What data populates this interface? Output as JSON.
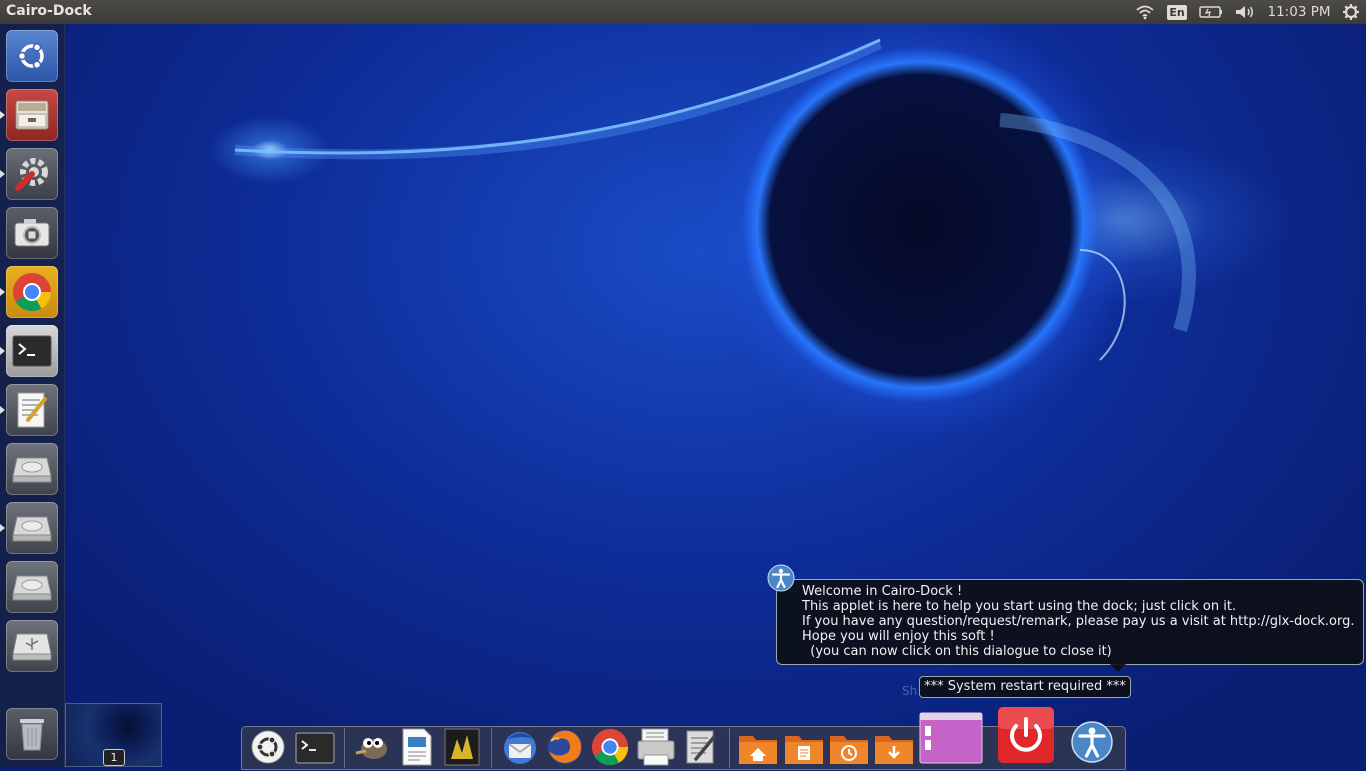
{
  "top_panel": {
    "app_title": "Cairo-Dock",
    "keyboard_layout": "En",
    "clock": "11:03 PM"
  },
  "launcher": {
    "items": [
      {
        "icon": "ubuntu-dash-icon"
      },
      {
        "icon": "file-cabinet-icon",
        "running": true
      },
      {
        "icon": "system-settings-icon",
        "running": true
      },
      {
        "icon": "camera-icon"
      },
      {
        "icon": "chrome-icon",
        "running": true
      },
      {
        "icon": "terminal-icon",
        "running": true
      },
      {
        "icon": "text-editor-icon",
        "running": true
      },
      {
        "icon": "hard-drive-icon"
      },
      {
        "icon": "hard-drive-icon",
        "running": true
      },
      {
        "icon": "hard-drive-icon"
      },
      {
        "icon": "usb-drive-icon"
      },
      {
        "icon": "trash-icon"
      }
    ]
  },
  "workspace": {
    "number": "1"
  },
  "dialog": {
    "line1": "Welcome in Cairo-Dock !",
    "line2": "This applet is here to help you start using the dock; just click on it.",
    "line3": "If you have any question/request/remark, please pay us a visit at http://glx-dock.org.",
    "line4": "Hope you will enjoy this soft !",
    "line5": "  (you can now click on this dialogue to close it)"
  },
  "restart_notice": "*** System restart required ***",
  "ghost_label": "Sh",
  "dock": {
    "items": [
      "ubuntu-icon",
      "terminal-icon",
      "gimp-icon",
      "document-viewer-icon",
      "image-viewer-icon",
      "thunderbird-icon",
      "firefox-icon",
      "chrome-icon",
      "scanner-icon",
      "text-editor-icon",
      "home-folder-icon",
      "documents-folder-icon",
      "recent-folder-icon",
      "downloads-folder-icon",
      "workspace-switcher-icon",
      "power-icon",
      "accessibility-help-icon"
    ]
  },
  "colors": {
    "panel": "#3c3b37",
    "dialog_bg": "#0c0e14",
    "power_red": "#e0272b",
    "folder_orange": "#f0862c"
  }
}
